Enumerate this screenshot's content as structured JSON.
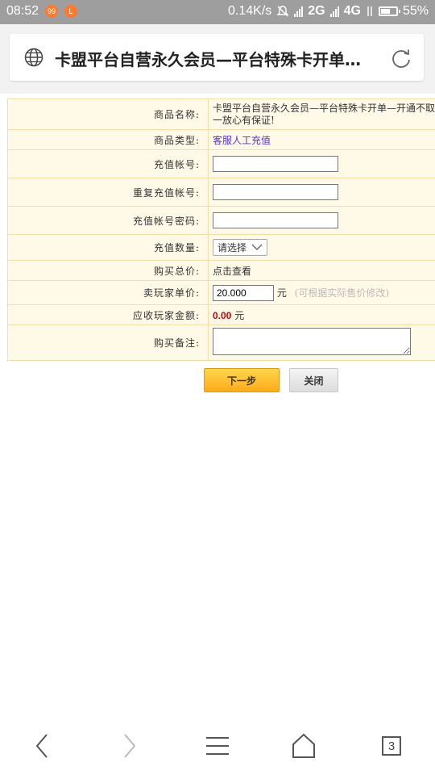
{
  "status_bar": {
    "time": "08:52",
    "badge1": "99",
    "badge2": "L",
    "speed": "0.14K/s",
    "net1": "2G",
    "net2": "4G",
    "battery": "55%"
  },
  "browser": {
    "page_title": "卡盟平台自营永久会员—平台特殊卡开单…",
    "tab_count": "3"
  },
  "form": {
    "product_name_label": "商品名称:",
    "product_name_line1": "卡盟平台自营永久会员—平台特殊卡开单—开通不取消",
    "product_name_line2": "一放心有保证!",
    "product_type_label": "商品类型:",
    "product_type_value": "客服人工充值",
    "account_label": "充值帐号:",
    "account_value": "",
    "repeat_account_label": "重复充值帐号:",
    "repeat_account_value": "",
    "password_label": "充值帐号密码:",
    "password_value": "",
    "quantity_label": "充值数量:",
    "quantity_selected": "请选择",
    "total_label": "购买总价:",
    "total_value": "点击查看",
    "unit_price_label": "卖玩家单价:",
    "unit_price_value": "20.000",
    "unit_price_unit": "元",
    "unit_price_hint": "(可根据实际售价修改)",
    "receivable_label": "应收玩家金额:",
    "receivable_value": "0.00",
    "receivable_unit": "元",
    "note_label": "购买备注:",
    "note_value": ""
  },
  "buttons": {
    "next": "下一步",
    "close": "关闭"
  }
}
